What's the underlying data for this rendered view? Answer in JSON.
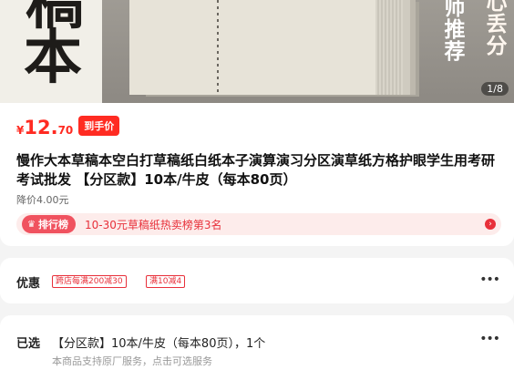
{
  "hero": {
    "char_top": "稿",
    "char_bottom": "本",
    "vertical_col1": "师推荐",
    "vertical_col2": "心丢分",
    "counter": "1/8"
  },
  "product": {
    "price_currency": "¥",
    "price_int": "12.",
    "price_dec": "70",
    "deal_badge": "到手价",
    "title": "慢作大本草稿本空白打草稿纸白纸本子演算演习分区演草纸方格护眼学生用考研考试批发 【分区款】10本/牛皮（每本80页）",
    "discount": "降价4.00元",
    "rank_label": "排行榜",
    "rank_text": "10-30元草稿纸热卖榜第3名",
    "rank_arrow": "›"
  },
  "promo": {
    "label": "优惠",
    "coupons": [
      "跨店每满200减30",
      "满10减4"
    ],
    "more": "•••"
  },
  "selection": {
    "label": "已选",
    "value": "【分区款】10本/牛皮（每本80页），1个",
    "note": "本商品支持原厂服务，点击可选服务",
    "more": "•••"
  },
  "colors": {
    "accent_red": "#ff2b22",
    "rank_bg": "#fdeceb",
    "rank_tag": "#f0525f"
  }
}
